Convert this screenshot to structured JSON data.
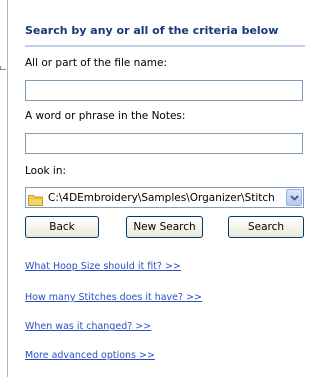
{
  "panel": {
    "heading": "Search by any or all of the criteria below",
    "file_name_label": "All or part of the file name:",
    "file_name_value": "",
    "notes_label": "A word or phrase in the Notes:",
    "notes_value": "",
    "look_in_label": "Look in:",
    "look_in_value": "C:\\4DEmbroidery\\Samples\\Organizer\\Stitch",
    "buttons": {
      "back": "Back",
      "new_search": "New Search",
      "search": "Search"
    },
    "links": [
      "What Hoop Size should it fit? >>",
      "How many Stitches does it have? >>",
      "When was it changed? >>",
      "More advanced options >>"
    ]
  },
  "icons": {
    "folder": "folder-icon",
    "dropdown": "chevron-down-icon"
  }
}
